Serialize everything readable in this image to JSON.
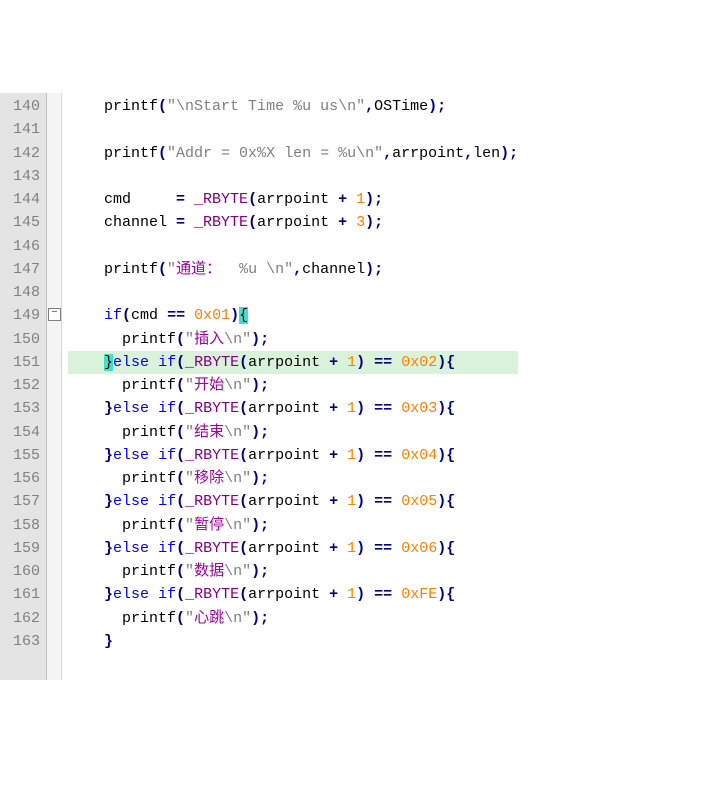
{
  "first_line": 140,
  "fold_marker_line": 149,
  "highlight_line": 151,
  "lines": [
    {
      "n": 140,
      "t": [
        [
          "sp",
          "    "
        ],
        [
          "fn",
          "printf"
        ],
        [
          "op",
          "("
        ],
        [
          "str",
          "\"\\nStart Time %u us\\n\""
        ],
        [
          "op",
          ","
        ],
        [
          "id",
          "OSTime"
        ],
        [
          "op",
          ");"
        ]
      ]
    },
    {
      "n": 141,
      "t": []
    },
    {
      "n": 142,
      "t": [
        [
          "sp",
          "    "
        ],
        [
          "fn",
          "printf"
        ],
        [
          "op",
          "("
        ],
        [
          "str",
          "\"Addr = 0x%X len = %u\\n\""
        ],
        [
          "op",
          ","
        ],
        [
          "id",
          "arrpoint"
        ],
        [
          "op",
          ","
        ],
        [
          "id",
          "len"
        ],
        [
          "op",
          ");"
        ]
      ]
    },
    {
      "n": 143,
      "t": []
    },
    {
      "n": 144,
      "t": [
        [
          "sp",
          "    "
        ],
        [
          "id",
          "cmd     "
        ],
        [
          "op",
          "= "
        ],
        [
          "macro",
          "_RBYTE"
        ],
        [
          "op",
          "("
        ],
        [
          "id",
          "arrpoint "
        ],
        [
          "op",
          "+ "
        ],
        [
          "num",
          "1"
        ],
        [
          "op",
          ");"
        ]
      ]
    },
    {
      "n": 145,
      "t": [
        [
          "sp",
          "    "
        ],
        [
          "id",
          "channel "
        ],
        [
          "op",
          "= "
        ],
        [
          "macro",
          "_RBYTE"
        ],
        [
          "op",
          "("
        ],
        [
          "id",
          "arrpoint "
        ],
        [
          "op",
          "+ "
        ],
        [
          "num",
          "3"
        ],
        [
          "op",
          ");"
        ]
      ]
    },
    {
      "n": 146,
      "t": []
    },
    {
      "n": 147,
      "t": [
        [
          "sp",
          "    "
        ],
        [
          "fn",
          "printf"
        ],
        [
          "op",
          "("
        ],
        [
          "str",
          "\""
        ],
        [
          "str-cn",
          "通道："
        ],
        [
          "str",
          "  %u \\n\""
        ],
        [
          "op",
          ","
        ],
        [
          "id",
          "channel"
        ],
        [
          "op",
          ");"
        ]
      ]
    },
    {
      "n": 148,
      "t": []
    },
    {
      "n": 149,
      "t": [
        [
          "sp",
          "    "
        ],
        [
          "kw",
          "if"
        ],
        [
          "op",
          "("
        ],
        [
          "id",
          "cmd "
        ],
        [
          "op",
          "== "
        ],
        [
          "num",
          "0x01"
        ],
        [
          "op",
          ")"
        ],
        [
          "brace-hl",
          "{"
        ]
      ]
    },
    {
      "n": 150,
      "t": [
        [
          "sp",
          "      "
        ],
        [
          "fn",
          "printf"
        ],
        [
          "op",
          "("
        ],
        [
          "str",
          "\""
        ],
        [
          "str-cn",
          "插入"
        ],
        [
          "str",
          "\\n\""
        ],
        [
          "op",
          ");"
        ]
      ]
    },
    {
      "n": 151,
      "t": [
        [
          "sp",
          "    "
        ],
        [
          "brace-hl",
          "}"
        ],
        [
          "kw",
          "else"
        ],
        [
          "sp",
          " "
        ],
        [
          "kw",
          "if"
        ],
        [
          "op",
          "("
        ],
        [
          "macro",
          "_RBYTE"
        ],
        [
          "op",
          "("
        ],
        [
          "id",
          "arrpoint "
        ],
        [
          "op",
          "+ "
        ],
        [
          "num",
          "1"
        ],
        [
          "op",
          ") == "
        ],
        [
          "num",
          "0x02"
        ],
        [
          "op",
          "){"
        ]
      ]
    },
    {
      "n": 152,
      "t": [
        [
          "sp",
          "      "
        ],
        [
          "fn",
          "printf"
        ],
        [
          "op",
          "("
        ],
        [
          "str",
          "\""
        ],
        [
          "str-cn",
          "开始"
        ],
        [
          "str",
          "\\n\""
        ],
        [
          "op",
          ");"
        ]
      ]
    },
    {
      "n": 153,
      "t": [
        [
          "sp",
          "    "
        ],
        [
          "op",
          "}"
        ],
        [
          "kw",
          "else"
        ],
        [
          "sp",
          " "
        ],
        [
          "kw",
          "if"
        ],
        [
          "op",
          "("
        ],
        [
          "macro",
          "_RBYTE"
        ],
        [
          "op",
          "("
        ],
        [
          "id",
          "arrpoint "
        ],
        [
          "op",
          "+ "
        ],
        [
          "num",
          "1"
        ],
        [
          "op",
          ") == "
        ],
        [
          "num",
          "0x03"
        ],
        [
          "op",
          "){"
        ]
      ]
    },
    {
      "n": 154,
      "t": [
        [
          "sp",
          "      "
        ],
        [
          "fn",
          "printf"
        ],
        [
          "op",
          "("
        ],
        [
          "str",
          "\""
        ],
        [
          "str-cn",
          "结束"
        ],
        [
          "str",
          "\\n\""
        ],
        [
          "op",
          ");"
        ]
      ]
    },
    {
      "n": 155,
      "t": [
        [
          "sp",
          "    "
        ],
        [
          "op",
          "}"
        ],
        [
          "kw",
          "else"
        ],
        [
          "sp",
          " "
        ],
        [
          "kw",
          "if"
        ],
        [
          "op",
          "("
        ],
        [
          "macro",
          "_RBYTE"
        ],
        [
          "op",
          "("
        ],
        [
          "id",
          "arrpoint "
        ],
        [
          "op",
          "+ "
        ],
        [
          "num",
          "1"
        ],
        [
          "op",
          ") == "
        ],
        [
          "num",
          "0x04"
        ],
        [
          "op",
          "){"
        ]
      ]
    },
    {
      "n": 156,
      "t": [
        [
          "sp",
          "      "
        ],
        [
          "fn",
          "printf"
        ],
        [
          "op",
          "("
        ],
        [
          "str",
          "\""
        ],
        [
          "str-cn",
          "移除"
        ],
        [
          "str",
          "\\n\""
        ],
        [
          "op",
          ");"
        ]
      ]
    },
    {
      "n": 157,
      "t": [
        [
          "sp",
          "    "
        ],
        [
          "op",
          "}"
        ],
        [
          "kw",
          "else"
        ],
        [
          "sp",
          " "
        ],
        [
          "kw",
          "if"
        ],
        [
          "op",
          "("
        ],
        [
          "macro",
          "_RBYTE"
        ],
        [
          "op",
          "("
        ],
        [
          "id",
          "arrpoint "
        ],
        [
          "op",
          "+ "
        ],
        [
          "num",
          "1"
        ],
        [
          "op",
          ") == "
        ],
        [
          "num",
          "0x05"
        ],
        [
          "op",
          "){"
        ]
      ]
    },
    {
      "n": 158,
      "t": [
        [
          "sp",
          "      "
        ],
        [
          "fn",
          "printf"
        ],
        [
          "op",
          "("
        ],
        [
          "str",
          "\""
        ],
        [
          "str-cn",
          "暂停"
        ],
        [
          "str",
          "\\n\""
        ],
        [
          "op",
          ");"
        ]
      ]
    },
    {
      "n": 159,
      "t": [
        [
          "sp",
          "    "
        ],
        [
          "op",
          "}"
        ],
        [
          "kw",
          "else"
        ],
        [
          "sp",
          " "
        ],
        [
          "kw",
          "if"
        ],
        [
          "op",
          "("
        ],
        [
          "macro",
          "_RBYTE"
        ],
        [
          "op",
          "("
        ],
        [
          "id",
          "arrpoint "
        ],
        [
          "op",
          "+ "
        ],
        [
          "num",
          "1"
        ],
        [
          "op",
          ") == "
        ],
        [
          "num",
          "0x06"
        ],
        [
          "op",
          "){"
        ]
      ]
    },
    {
      "n": 160,
      "t": [
        [
          "sp",
          "      "
        ],
        [
          "fn",
          "printf"
        ],
        [
          "op",
          "("
        ],
        [
          "str",
          "\""
        ],
        [
          "str-cn",
          "数据"
        ],
        [
          "str",
          "\\n\""
        ],
        [
          "op",
          ");"
        ]
      ]
    },
    {
      "n": 161,
      "t": [
        [
          "sp",
          "    "
        ],
        [
          "op",
          "}"
        ],
        [
          "kw",
          "else"
        ],
        [
          "sp",
          " "
        ],
        [
          "kw",
          "if"
        ],
        [
          "op",
          "("
        ],
        [
          "macro",
          "_RBYTE"
        ],
        [
          "op",
          "("
        ],
        [
          "id",
          "arrpoint "
        ],
        [
          "op",
          "+ "
        ],
        [
          "num",
          "1"
        ],
        [
          "op",
          ") == "
        ],
        [
          "num",
          "0xFE"
        ],
        [
          "op",
          "){"
        ]
      ]
    },
    {
      "n": 162,
      "t": [
        [
          "sp",
          "      "
        ],
        [
          "fn",
          "printf"
        ],
        [
          "op",
          "("
        ],
        [
          "str",
          "\""
        ],
        [
          "str-cn",
          "心跳"
        ],
        [
          "str",
          "\\n\""
        ],
        [
          "op",
          ");"
        ]
      ]
    },
    {
      "n": 163,
      "t": [
        [
          "sp",
          "    "
        ],
        [
          "op",
          "}"
        ]
      ]
    }
  ]
}
